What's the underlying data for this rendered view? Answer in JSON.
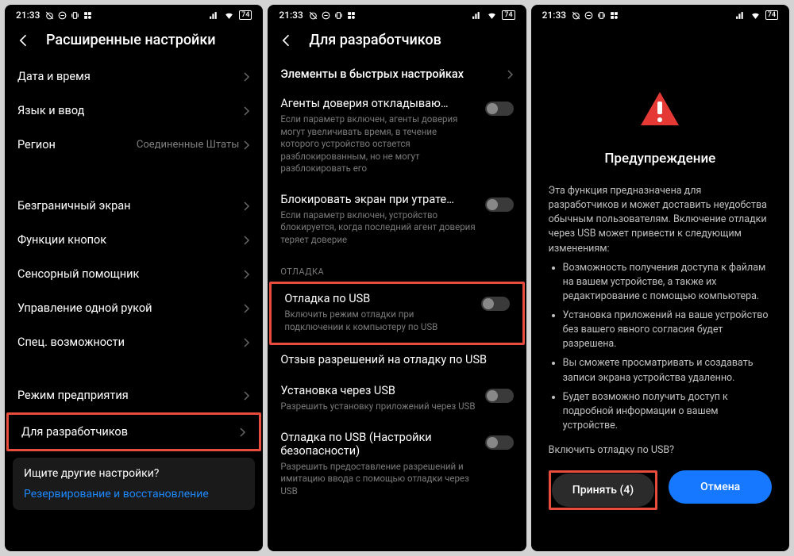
{
  "statusbar": {
    "time": "21:33",
    "battery": "74"
  },
  "screen1": {
    "title": "Расширенные настройки",
    "rows": [
      {
        "label": "Дата и время"
      },
      {
        "label": "Язык и ввод"
      },
      {
        "label": "Регион",
        "value": "Соединенные Штаты"
      }
    ],
    "rows2": [
      {
        "label": "Безграничный экран"
      },
      {
        "label": "Функции кнопок"
      },
      {
        "label": "Сенсорный помощник"
      },
      {
        "label": "Управление одной рукой"
      },
      {
        "label": "Спец. возможности"
      }
    ],
    "rows3": [
      {
        "label": "Режим предприятия"
      },
      {
        "label": "Для разработчиков"
      }
    ],
    "hint": {
      "question": "Ищите другие настройки?",
      "link": "Резервирование и восстановление"
    }
  },
  "screen2": {
    "title": "Для разработчиков",
    "topRow": {
      "label": "Элементы в быстрых настройках"
    },
    "settings1": [
      {
        "title": "Агенты доверия откладываю…",
        "desc": "Если параметр включен, агенты доверия могут увеличивать время, в течение которого устройство остается разблокированным, но не могут разблокировать его"
      },
      {
        "title": "Блокировать экран при утрате…",
        "desc": "Если параметр включен, устройство блокируется, когда последний агент доверия теряет доверие"
      }
    ],
    "sectionLabel": "ОТЛАДКА",
    "usbDebug": {
      "title": "Отладка по USB",
      "desc": "Включить режим отладки при подключении к компьютеру по USB"
    },
    "settings2": [
      {
        "title": "Отзыв разрешений на отладку по USB",
        "desc": ""
      },
      {
        "title": "Установка через USB",
        "desc": "Разрешить установку приложений через USB"
      },
      {
        "title": "Отладка по USB (Настройки безопасности)",
        "desc": "Разрешить предоставление разрешений и имитацию ввода с помощью отладки через USB"
      }
    ]
  },
  "screen3": {
    "title": "Предупреждение",
    "intro": "Эта функция предназначена для разработчиков и может доставить неудобства обычным пользователям. Включение отладки через USB может привести к следующим изменениям:",
    "bullets": [
      "Возможность получения доступа к файлам на вашем устройстве, а также их редактирование с помощью компьютера.",
      "Установка приложений на ваше устройство без вашего явного согласия будет разрешена.",
      "Вы сможете просматривать и создавать записи экрана устройства удаленно.",
      "Будет возможно получить доступ к подробной информации о вашем устройстве."
    ],
    "question": "Включить отладку по USB?",
    "accept": "Принять (4)",
    "cancel": "Отмена"
  }
}
